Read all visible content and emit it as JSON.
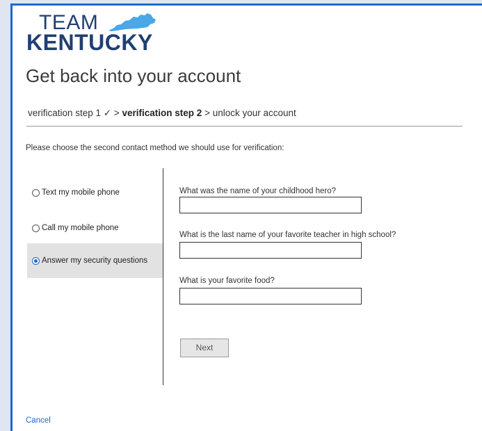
{
  "logo": {
    "line1": "TEAM",
    "line2": "KENTUCKY",
    "state_shape": "kentucky-state-icon",
    "accent_color": "#4aa8e8"
  },
  "page_title": "Get back into your account",
  "steps": {
    "step1": "verification step 1 ✓",
    "sep1": " > ",
    "step2": "verification step 2",
    "sep2": " > ",
    "step3": "unlock your account"
  },
  "instruction": "Please choose the second contact method we should use for verification:",
  "methods": [
    {
      "label": "Text my mobile phone",
      "selected": false
    },
    {
      "label": "Call my mobile phone",
      "selected": false
    },
    {
      "label": "Answer my security questions",
      "selected": true
    }
  ],
  "questions": [
    {
      "label": "What was the name of your childhood hero?",
      "value": ""
    },
    {
      "label": "What is the last name of your favorite teacher in high school?",
      "value": ""
    },
    {
      "label": "What is your favorite food?",
      "value": ""
    }
  ],
  "next_label": "Next",
  "cancel_label": "Cancel",
  "colors": {
    "frame": "#1b6ac9",
    "brand": "#1f3f73",
    "link": "#1b6ac9",
    "selected_bg": "#e2e2e2"
  }
}
